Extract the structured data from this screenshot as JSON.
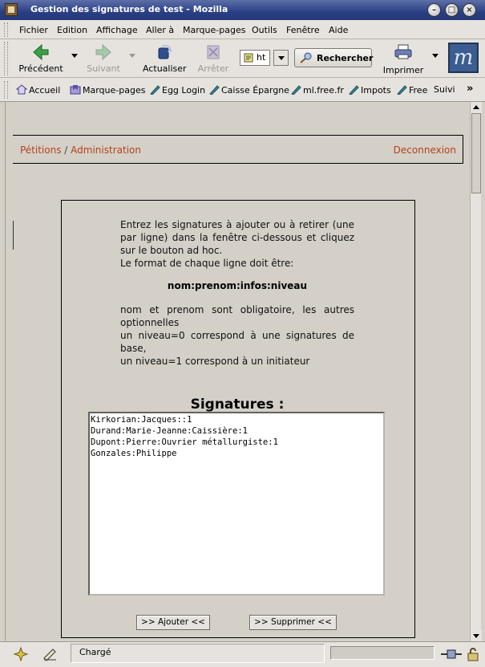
{
  "window": {
    "title": "Gestion des signatures de test - Mozilla",
    "controls": {
      "minimize": "–",
      "maximize": "□",
      "close": "×"
    }
  },
  "menubar": {
    "items": [
      "Fichier",
      "Edition",
      "Affichage",
      "Aller à",
      "Marque-pages",
      "Outils",
      "Fenêtre",
      "Aide"
    ]
  },
  "navbar": {
    "back": "Précédent",
    "forward": "Suivant",
    "reload": "Actualiser",
    "stop": "Arrêter",
    "url_value": "ht",
    "search": "Rechercher",
    "print": "Imprimer"
  },
  "bookmarks": {
    "items": [
      "Accueil",
      "Marque-pages",
      "Egg Login",
      "Caisse Épargne",
      "ml.free.fr",
      "Impots",
      "Free",
      "Suivi"
    ],
    "overflow": "»"
  },
  "page": {
    "breadcrumb": {
      "first": "Pétitions",
      "separator": "/",
      "second": "Administration"
    },
    "logout": "Deconnexion",
    "instructions": "Entrez les signatures à ajouter ou à retirer (une par ligne) dans la fenêtre ci-dessous et cliquez sur le bouton ad hoc.",
    "format_intro": "Le format de chaque ligne doit être:",
    "format": "nom:prenom:infos:niveau",
    "note_required": "nom et prenom sont obligatoire, les autres optionnelles",
    "note_level0": "un niveau=0 correspond à une signatures de base,",
    "note_level1": "un niveau=1 correspond à un initiateur",
    "signatures_title": "Signatures :",
    "signatures_text": "Kirkorian:Jacques::1\nDurand:Marie-Jeanne:Caissière:1\nDupont:Pierre:Ouvrier métallurgiste:1\nGonzales:Philippe",
    "add_button": ">> Ajouter <<",
    "remove_button": ">> Supprimer <<"
  },
  "statusbar": {
    "message": "Chargé"
  }
}
